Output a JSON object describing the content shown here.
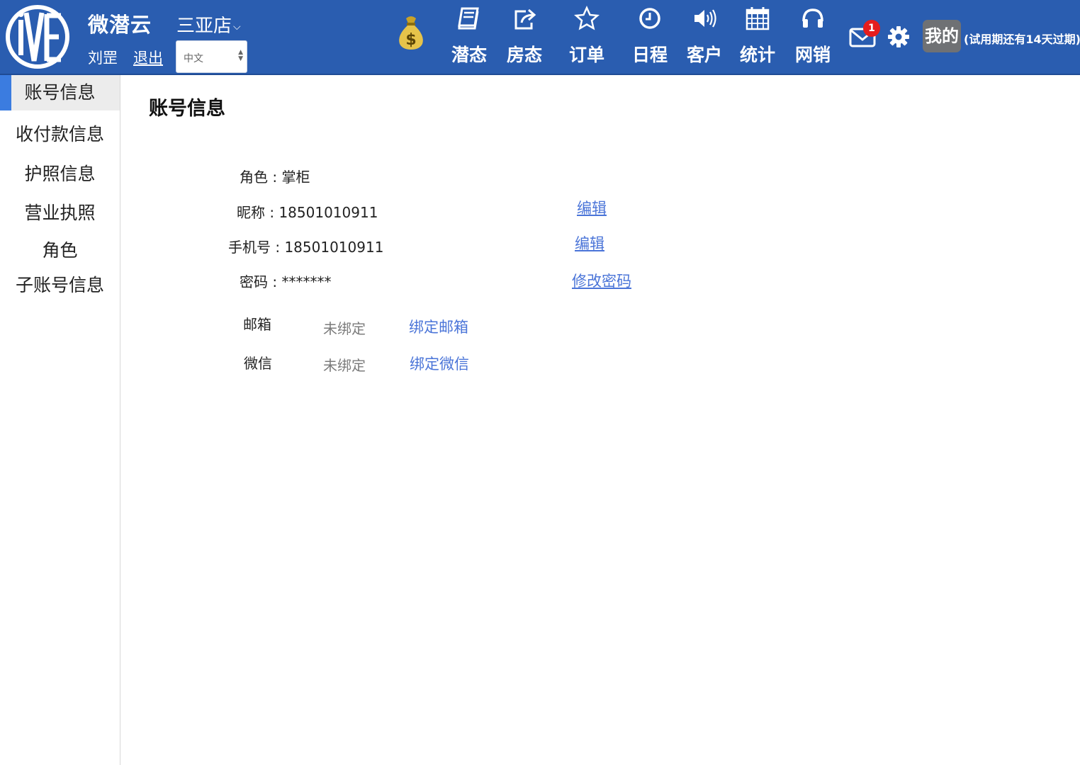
{
  "header": {
    "app_title": "微潜云",
    "store_name": "三亚店",
    "user_name": "刘罡",
    "logout_label": "退出",
    "language": "中文",
    "nav": [
      {
        "label": "潜态",
        "icon": "book-icon"
      },
      {
        "label": "房态",
        "icon": "share-icon"
      },
      {
        "label": "订单",
        "icon": "star-icon"
      },
      {
        "label": "日程",
        "icon": "clock-icon"
      },
      {
        "label": "客户",
        "icon": "volume-icon"
      },
      {
        "label": "统计",
        "icon": "calendar-icon"
      },
      {
        "label": "网销",
        "icon": "headphones-icon"
      }
    ],
    "mail_badge": "1",
    "mine_label": "我的",
    "trial_text": "(试用期还有14天过期)",
    "brand_color": "#2a5db0"
  },
  "sidebar": {
    "items": [
      {
        "label": "账号信息",
        "active": true
      },
      {
        "label": "收付款信息"
      },
      {
        "label": "护照信息"
      },
      {
        "label": "营业执照"
      },
      {
        "label": "角色"
      },
      {
        "label": "子账号信息"
      }
    ]
  },
  "main": {
    "title": "账号信息",
    "role": "角色 : 掌柜",
    "nickname": "昵称 : 18501010911",
    "nickname_edit": "编辑",
    "phone": "手机号 : 18501010911",
    "phone_edit": "编辑",
    "password": "密码 : *******",
    "change_password": "修改密码",
    "email_label": "邮箱",
    "email_status": "未绑定",
    "email_bind": "绑定邮箱",
    "wechat_label": "微信",
    "wechat_status": "未绑定",
    "wechat_bind": "绑定微信",
    "link_color": "#4a74d8"
  }
}
